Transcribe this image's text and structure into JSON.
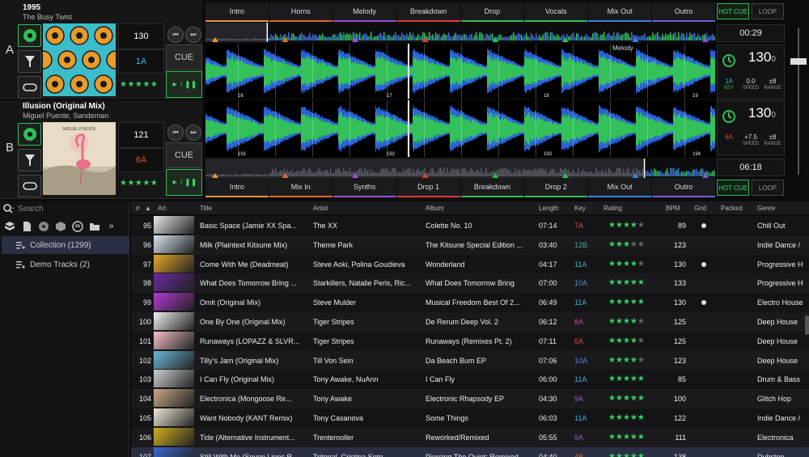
{
  "deck_a": {
    "letter": "A",
    "title": "1995",
    "artist": "The Busy Twist",
    "bpm": "130",
    "key": "1A",
    "stars": "★★★★★",
    "cue": "CUE",
    "play": "► / ❚❚",
    "time": "00:29",
    "bpm_big": "130",
    "bpm_small": "0",
    "key_small": "1A",
    "key_label": "KEY",
    "speed": "0.0",
    "speed_label": "SPEED",
    "range": "±8",
    "range_label": "RANGE",
    "hot_cue": "HOT CUE",
    "loop": "LOOP",
    "overview_label": "Melody",
    "beats": [
      "16",
      "17",
      "18",
      "19"
    ],
    "cues": [
      {
        "label": "Intro",
        "color": "#e59a2e"
      },
      {
        "label": "Horns",
        "color": "#e06a2a"
      },
      {
        "label": "Melody",
        "color": "#9a4fd6"
      },
      {
        "label": "Breakdown",
        "color": "#e23a3a"
      },
      {
        "label": "Drop",
        "color": "#2fbf57"
      },
      {
        "label": "Vocals",
        "color": "#2fbf57"
      },
      {
        "label": "Mix Out",
        "color": "#3b82e0"
      },
      {
        "label": "Outro",
        "color": "#7b5ad6"
      }
    ]
  },
  "deck_b": {
    "letter": "B",
    "title": "Illusion (Original Mix)",
    "artist": "Miguel Puente, Sandeman",
    "bpm": "121",
    "key": "6A",
    "stars": "★★★★★",
    "cue": "CUE",
    "play": "► / ❚❚",
    "time": "06:18",
    "bpm_big": "130",
    "bpm_small": "0",
    "key_small": "6A",
    "speed": "+7.5",
    "speed_label": "SPEED",
    "range": "±8",
    "range_label": "RANGE",
    "hot_cue": "HOT CUE",
    "loop": "LOOP",
    "beats": [
      "191",
      "192",
      "193",
      "194"
    ],
    "art_text": "MIGUEL PUENTE",
    "cues": [
      {
        "label": "Intro",
        "color": "#e59a2e"
      },
      {
        "label": "Mix In",
        "color": "#e06a2a"
      },
      {
        "label": "Synths",
        "color": "#9a4fd6"
      },
      {
        "label": "Drop 1",
        "color": "#e23a3a"
      },
      {
        "label": "Breakdown",
        "color": "#2fbf57"
      },
      {
        "label": "Drop 2",
        "color": "#2fbf57"
      },
      {
        "label": "Mix Out",
        "color": "#3b82e0"
      },
      {
        "label": "Outro",
        "color": "#7b5ad6"
      }
    ]
  },
  "library": {
    "search_placeholder": "Search",
    "crates": [
      {
        "label": "Collection (1299)",
        "selected": true
      },
      {
        "label": "Demo Tracks (2)",
        "selected": false
      }
    ],
    "columns": [
      "#",
      "Art",
      "Title",
      "Artist",
      "Album",
      "Length",
      "Key",
      "Rating",
      "BPM",
      "Grid",
      "Packed",
      "Genre"
    ],
    "rows": [
      {
        "n": "95",
        "title": "Basic Space (Jamie XX Spa...",
        "artist": "The XX",
        "album": "Colette No. 10",
        "length": "07:14",
        "key": "7A",
        "keycolor": "#e24a4a",
        "rating": 4,
        "bpm": "89",
        "grid": true,
        "genre": "Chill Out",
        "thumb": "#e8e8e8"
      },
      {
        "n": "96",
        "title": "Milk (Plaintext Kitsune Mix)",
        "artist": "Theme Park",
        "album": "The Kitsune Special Edition ...",
        "length": "03:40",
        "key": "12B",
        "keycolor": "#3fa8b0",
        "rating": 3,
        "bpm": "123",
        "grid": false,
        "genre": "Indie Dance /",
        "thumb": "#d9e4ec"
      },
      {
        "n": "97",
        "title": "Come With Me (Deadmeat)",
        "artist": "Steve Aoki, Polina Goudieva",
        "album": "Wonderland",
        "length": "04:17",
        "key": "11A",
        "keycolor": "#3fb4d6",
        "rating": 4,
        "bpm": "130",
        "grid": true,
        "genre": "Progressive H",
        "thumb": "#e6a72a"
      },
      {
        "n": "98",
        "title": "What Does Tomorrow Bring ...",
        "artist": "Starkillers, Natalie Peris, Ric...",
        "album": "What Does Tomorrow Bring",
        "length": "07:00",
        "key": "10A",
        "keycolor": "#4a8ee0",
        "rating": 5,
        "bpm": "133",
        "grid": false,
        "genre": "Progressive H",
        "thumb": "#6a2aa0"
      },
      {
        "n": "99",
        "title": "Omit (Original Mix)",
        "artist": "Steve Mulder",
        "album": "Musical Freedom Best Of 2...",
        "length": "06:49",
        "key": "11A",
        "keycolor": "#3fb4d6",
        "rating": 5,
        "bpm": "130",
        "grid": true,
        "genre": "Electro House",
        "thumb": "#b23ad0"
      },
      {
        "n": "100",
        "title": "One By One (Original Mix)",
        "artist": "Tiger Stripes",
        "album": "De Rerum Deep Vol. 2",
        "length": "06:12",
        "key": "8A",
        "keycolor": "#d04aa0",
        "rating": 4,
        "bpm": "125",
        "grid": false,
        "genre": "Deep House",
        "thumb": "#f0f0f0"
      },
      {
        "n": "101",
        "title": "Runaways (LOPAZZ & SLVR...",
        "artist": "Tiger Stripes",
        "album": "Runaways (Remixes Pt. 2)",
        "length": "07:11",
        "key": "6A",
        "keycolor": "#e04a3a",
        "rating": 4,
        "bpm": "125",
        "grid": false,
        "genre": "Deep House",
        "thumb": "#f4c0c8"
      },
      {
        "n": "102",
        "title": "Tilly's Jam (Original Mix)",
        "artist": "Till Von Sein",
        "album": "Da Beach Bum EP",
        "length": "07:06",
        "key": "10A",
        "keycolor": "#4a8ee0",
        "rating": 4,
        "bpm": "123",
        "grid": false,
        "genre": "Deep House",
        "thumb": "#6ab8d8"
      },
      {
        "n": "103",
        "title": "I Can Fly (Original Mix)",
        "artist": "Tony Awake, NuAnn",
        "album": "I Can Fly",
        "length": "06:00",
        "key": "11A",
        "keycolor": "#3fb4d6",
        "rating": 5,
        "bpm": "85",
        "grid": false,
        "genre": "Drum & Bass",
        "thumb": "#cfcfcf"
      },
      {
        "n": "104",
        "title": "Electronica (Mongoose Re...",
        "artist": "Tony Awake",
        "album": "Electronic Rhapsody EP",
        "length": "04:30",
        "key": "9A",
        "keycolor": "#9a5ad6",
        "rating": 5,
        "bpm": "100",
        "grid": false,
        "genre": "Glitch Hop",
        "thumb": "#c8a88a"
      },
      {
        "n": "105",
        "title": "Want Nobody (KANT Remix)",
        "artist": "Tony Casanova",
        "album": "Some Things",
        "length": "06:03",
        "key": "11A",
        "keycolor": "#3fb4d6",
        "rating": 5,
        "bpm": "122",
        "grid": false,
        "genre": "Indie Dance /",
        "thumb": "#f0e8d8"
      },
      {
        "n": "106",
        "title": "Tide (Alternative Instrument...",
        "artist": "Trentemoller",
        "album": "Reworked/Remixed",
        "length": "05:55",
        "key": "9A",
        "keycolor": "#9a5ad6",
        "rating": 5,
        "bpm": "111",
        "grid": false,
        "genre": "Electronica",
        "thumb": "#d0b020"
      },
      {
        "n": "107",
        "title": "Still With Me (Seven Lions R...",
        "artist": "Tritonal, Cristina Soto",
        "album": "Piercing The Quiet: Remixed",
        "length": "04:40",
        "key": "4B",
        "keycolor": "#e06a2a",
        "rating": 5,
        "bpm": "138",
        "grid": false,
        "genre": "Dubstep",
        "thumb": "#3a6ad0"
      }
    ]
  }
}
